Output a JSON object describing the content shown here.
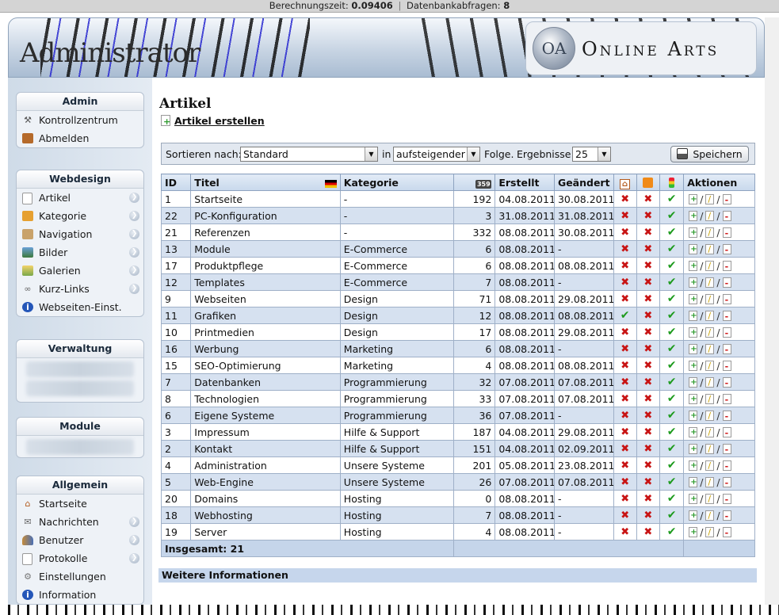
{
  "topbar": {
    "calc_label": "Berechnungszeit:",
    "calc_value": "0.09406",
    "db_label": "Datenbankabfragen:",
    "db_value": "8"
  },
  "header": {
    "logo_text": "Administrator",
    "brand": "Online Arts",
    "emblem_text": "OA"
  },
  "sidebar": {
    "admin": {
      "title": "Admin",
      "items": [
        {
          "label": "Kontrollzentrum",
          "icon": "wrench-icon"
        },
        {
          "label": "Abmelden",
          "icon": "door-icon"
        }
      ]
    },
    "webdesign": {
      "title": "Webdesign",
      "items": [
        {
          "label": "Artikel",
          "icon": "page-icon"
        },
        {
          "label": "Kategorie",
          "icon": "category-icon"
        },
        {
          "label": "Navigation",
          "icon": "signpost-icon"
        },
        {
          "label": "Bilder",
          "icon": "picture-icon"
        },
        {
          "label": "Galerien",
          "icon": "gallery-icon"
        },
        {
          "label": "Kurz-Links",
          "icon": "link-icon"
        },
        {
          "label": "Webseiten-Einst.",
          "icon": "info-icon"
        }
      ]
    },
    "verwaltung": {
      "title": "Verwaltung"
    },
    "module": {
      "title": "Module"
    },
    "allgemein": {
      "title": "Allgemein",
      "items": [
        {
          "label": "Startseite",
          "icon": "home-icon"
        },
        {
          "label": "Nachrichten",
          "icon": "mail-icon"
        },
        {
          "label": "Benutzer",
          "icon": "users-icon"
        },
        {
          "label": "Protokolle",
          "icon": "log-icon"
        },
        {
          "label": "Einstellungen",
          "icon": "gear-icon"
        },
        {
          "label": "Information",
          "icon": "info-icon"
        }
      ]
    }
  },
  "main": {
    "title": "Artikel",
    "create_link": "Artikel erstellen",
    "sort": {
      "label": "Sortieren nach:",
      "field_value": "Standard",
      "in_label": "in",
      "order_value": "aufsteigender",
      "folge_label": "Folge.",
      "results_label": "Ergebnisse:",
      "results_value": "25",
      "save_label": "Speichern"
    },
    "table": {
      "headers": {
        "id": "ID",
        "title": "Titel",
        "category": "Kategorie",
        "views_icon": "359",
        "created": "Erstellt",
        "changed": "Geändert",
        "actions": "Aktionen"
      },
      "rows": [
        {
          "id": "1",
          "title": "Startseite",
          "category": "-",
          "views": "192",
          "created": "04.08.2011",
          "changed": "30.08.2011",
          "home": false,
          "rss": false,
          "active": true
        },
        {
          "id": "22",
          "title": "PC-Konfiguration",
          "category": "-",
          "views": "3",
          "created": "31.08.2011",
          "changed": "31.08.2011",
          "home": false,
          "rss": false,
          "active": true
        },
        {
          "id": "21",
          "title": "Referenzen",
          "category": "-",
          "views": "332",
          "created": "08.08.2011",
          "changed": "30.08.2011",
          "home": false,
          "rss": false,
          "active": true
        },
        {
          "id": "13",
          "title": "Module",
          "category": "E-Commerce",
          "views": "6",
          "created": "08.08.2011",
          "changed": "-",
          "home": false,
          "rss": false,
          "active": true
        },
        {
          "id": "17",
          "title": "Produktpflege",
          "category": "E-Commerce",
          "views": "6",
          "created": "08.08.2011",
          "changed": "08.08.2011",
          "home": false,
          "rss": false,
          "active": true
        },
        {
          "id": "12",
          "title": "Templates",
          "category": "E-Commerce",
          "views": "7",
          "created": "08.08.2011",
          "changed": "-",
          "home": false,
          "rss": false,
          "active": true
        },
        {
          "id": "9",
          "title": "Webseiten",
          "category": "Design",
          "views": "71",
          "created": "08.08.2011",
          "changed": "29.08.2011",
          "home": false,
          "rss": false,
          "active": true
        },
        {
          "id": "11",
          "title": "Grafiken",
          "category": "Design",
          "views": "12",
          "created": "08.08.2011",
          "changed": "08.08.2011",
          "home": true,
          "rss": false,
          "active": true
        },
        {
          "id": "10",
          "title": "Printmedien",
          "category": "Design",
          "views": "17",
          "created": "08.08.2011",
          "changed": "29.08.2011",
          "home": false,
          "rss": false,
          "active": true
        },
        {
          "id": "16",
          "title": "Werbung",
          "category": "Marketing",
          "views": "6",
          "created": "08.08.2011",
          "changed": "-",
          "home": false,
          "rss": false,
          "active": true
        },
        {
          "id": "15",
          "title": "SEO-Optimierung",
          "category": "Marketing",
          "views": "4",
          "created": "08.08.2011",
          "changed": "08.08.2011",
          "home": false,
          "rss": false,
          "active": true
        },
        {
          "id": "7",
          "title": "Datenbanken",
          "category": "Programmierung",
          "views": "32",
          "created": "07.08.2011",
          "changed": "07.08.2011",
          "home": false,
          "rss": false,
          "active": true
        },
        {
          "id": "8",
          "title": "Technologien",
          "category": "Programmierung",
          "views": "33",
          "created": "07.08.2011",
          "changed": "07.08.2011",
          "home": false,
          "rss": false,
          "active": true
        },
        {
          "id": "6",
          "title": "Eigene Systeme",
          "category": "Programmierung",
          "views": "36",
          "created": "07.08.2011",
          "changed": "-",
          "home": false,
          "rss": false,
          "active": true
        },
        {
          "id": "3",
          "title": "Impressum",
          "category": "Hilfe & Support",
          "views": "187",
          "created": "04.08.2011",
          "changed": "29.08.2011",
          "home": false,
          "rss": false,
          "active": true
        },
        {
          "id": "2",
          "title": "Kontakt",
          "category": "Hilfe & Support",
          "views": "151",
          "created": "04.08.2011",
          "changed": "02.09.2011",
          "home": false,
          "rss": false,
          "active": true
        },
        {
          "id": "4",
          "title": "Administration",
          "category": "Unsere Systeme",
          "views": "201",
          "created": "05.08.2011",
          "changed": "23.08.2011",
          "home": false,
          "rss": false,
          "active": true
        },
        {
          "id": "5",
          "title": "Web-Engine",
          "category": "Unsere Systeme",
          "views": "26",
          "created": "07.08.2011",
          "changed": "07.08.2011",
          "home": false,
          "rss": false,
          "active": true
        },
        {
          "id": "20",
          "title": "Domains",
          "category": "Hosting",
          "views": "0",
          "created": "08.08.2011",
          "changed": "-",
          "home": false,
          "rss": false,
          "active": true
        },
        {
          "id": "18",
          "title": "Webhosting",
          "category": "Hosting",
          "views": "7",
          "created": "08.08.2011",
          "changed": "-",
          "home": false,
          "rss": false,
          "active": true
        },
        {
          "id": "19",
          "title": "Server",
          "category": "Hosting",
          "views": "4",
          "created": "08.08.2011",
          "changed": "-",
          "home": false,
          "rss": false,
          "active": true
        }
      ],
      "total": "Insgesamt: 21"
    },
    "more_info": "Weitere Informationen"
  },
  "colors": {
    "row_alt": "#d6e1f0",
    "header_bg": "#c8d8ec",
    "cross": "#c81414",
    "check": "#1e9b1e"
  }
}
